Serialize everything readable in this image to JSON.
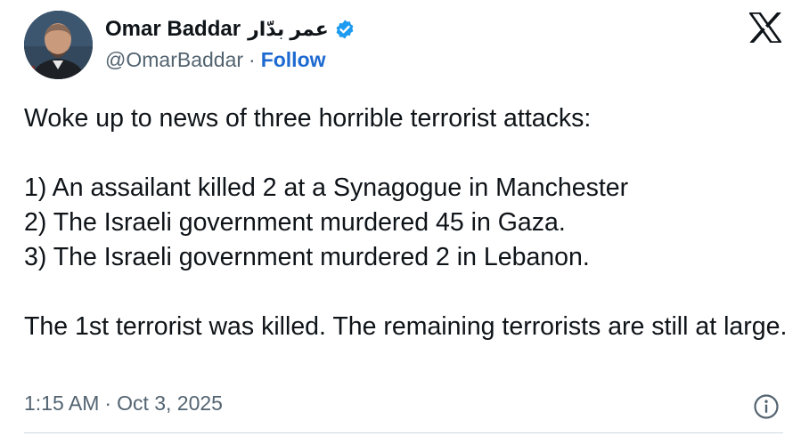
{
  "author": {
    "display_name": "Omar Baddar",
    "arabic_name": "عمر بدّار",
    "handle": "@OmarBaddar",
    "separator": "·",
    "follow_label": "Follow"
  },
  "tweet": {
    "lines": [
      "Woke up to news of three horrible terrorist attacks:",
      "1) An assailant killed 2 at a Synagogue in Manchester",
      "2) The Israeli government murdered 45 in Gaza.",
      "3) The Israeli government murdered 2 in Lebanon.",
      "The 1st terrorist was killed. The remaining terrorists are still at large."
    ]
  },
  "meta": {
    "time": "1:15 AM",
    "separator": "·",
    "date": "Oct 3, 2025"
  },
  "icons": {
    "verified": "verified-badge-icon",
    "platform_logo": "x-logo-icon",
    "info": "info-icon"
  },
  "colors": {
    "verified": "#1d9bf0",
    "follow": "#1d6ad1",
    "text": "#0f1419",
    "secondary": "#536471"
  }
}
